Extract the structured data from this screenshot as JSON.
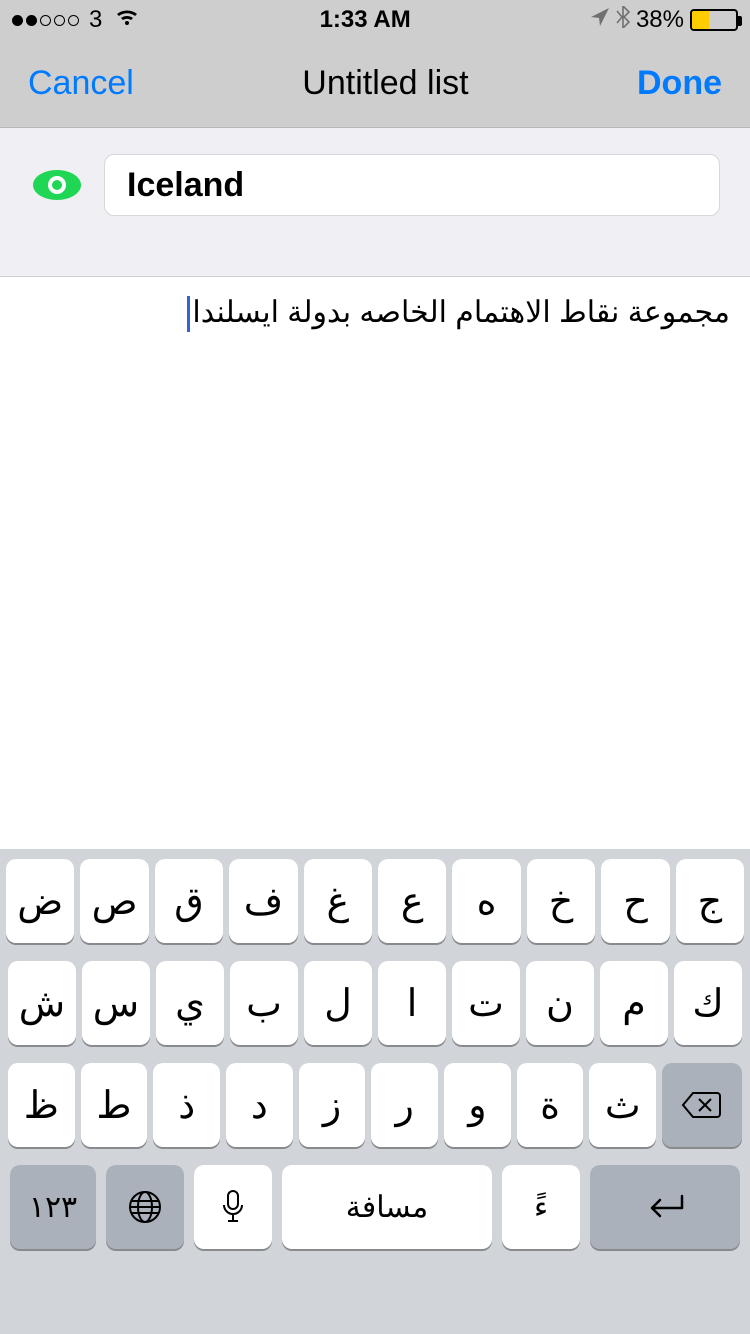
{
  "status": {
    "carrier": "3",
    "time": "1:33 AM",
    "battery_pct": "38%"
  },
  "nav": {
    "cancel": "Cancel",
    "title": "Untitled list",
    "done": "Done"
  },
  "title_input": {
    "value": "Iceland"
  },
  "content": {
    "text": "مجموعة نقاط الاهتمام الخاصه بدولة ايسلندا"
  },
  "keyboard": {
    "row1": [
      "ض",
      "ص",
      "ق",
      "ف",
      "غ",
      "ع",
      "ه",
      "خ",
      "ح",
      "ج"
    ],
    "row2": [
      "ش",
      "س",
      "ي",
      "ب",
      "ل",
      "ا",
      "ت",
      "ن",
      "م",
      "ك"
    ],
    "row3": [
      "ظ",
      "ط",
      "ذ",
      "د",
      "ز",
      "ر",
      "و",
      "ة",
      "ث"
    ],
    "num": "١٢٣",
    "space": "مسافة",
    "diac": "ءً",
    "ret": "↵"
  }
}
